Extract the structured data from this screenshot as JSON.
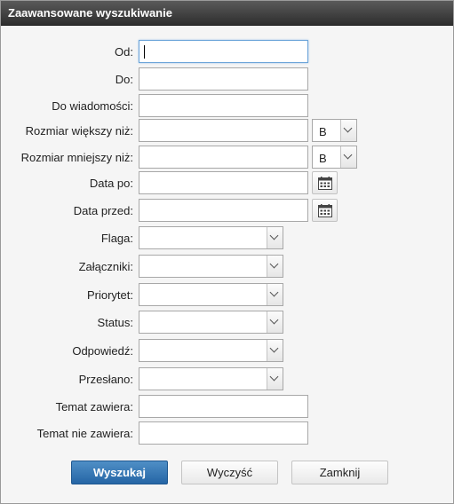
{
  "dialog": {
    "title": "Zaawansowane wyszukiwanie"
  },
  "fields": {
    "from_label": "Od:",
    "to_label": "Do:",
    "to_message_label": "Do wiadomości:",
    "size_greater_label": "Rozmiar większy niż:",
    "size_greater_unit": "B",
    "size_less_label": "Rozmiar mniejszy niż:",
    "size_less_unit": "B",
    "date_after_label": "Data po:",
    "date_before_label": "Data przed:",
    "flag_label": "Flaga:",
    "attachments_label": "Załączniki:",
    "priority_label": "Priorytet:",
    "status_label": "Status:",
    "reply_label": "Odpowiedź:",
    "forwarded_label": "Przesłano:",
    "subject_contains_label": "Temat zawiera:",
    "subject_not_contains_label": "Temat nie zawiera:"
  },
  "buttons": {
    "search": "Wyszukaj",
    "clear": "Wyczyść",
    "close": "Zamknij"
  },
  "icons": {
    "calendar": "calendar-icon",
    "dropdown": "chevron-down-icon"
  },
  "colors": {
    "titlebar": "#3a3a3a",
    "primary_button": "#2f6fae",
    "focus_border": "#6aa3d8"
  }
}
